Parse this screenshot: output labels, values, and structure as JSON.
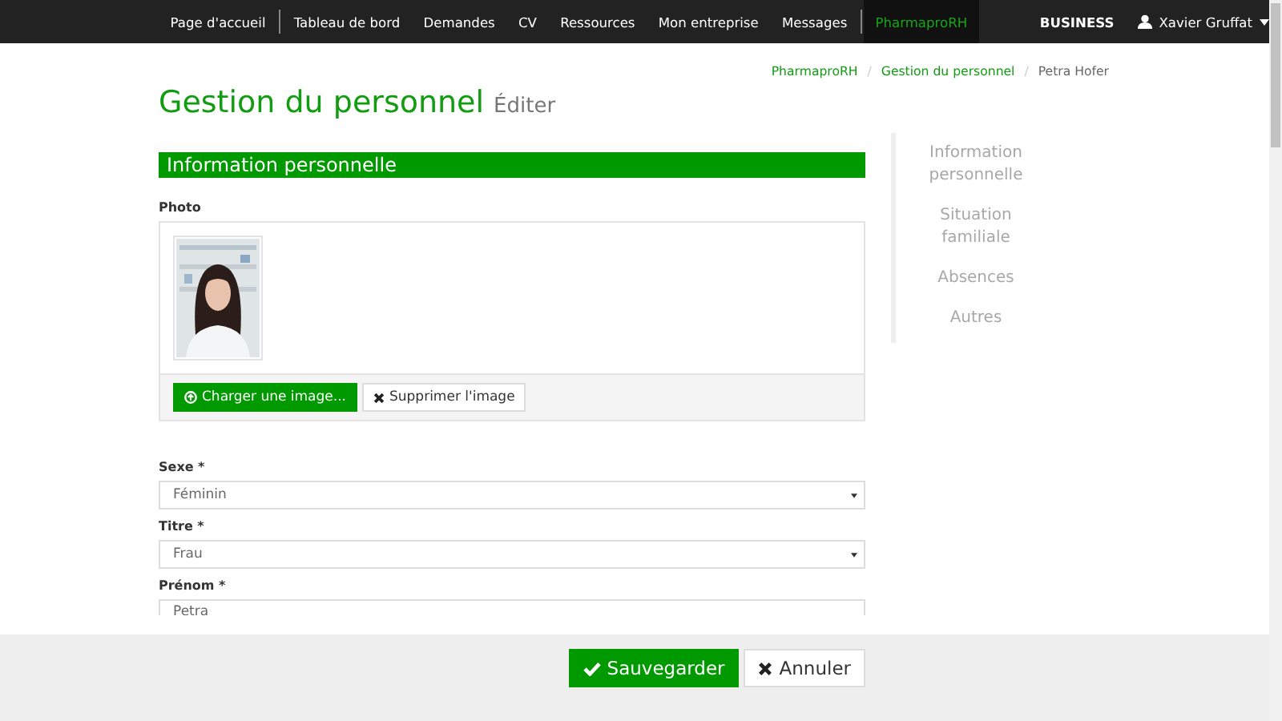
{
  "navbar": {
    "items": [
      {
        "label": "Page d'accueil",
        "selected": false,
        "separator_after": true
      },
      {
        "label": "Tableau de bord",
        "selected": false,
        "separator_after": false
      },
      {
        "label": "Demandes",
        "selected": false,
        "separator_after": false
      },
      {
        "label": "CV",
        "selected": false,
        "separator_after": false
      },
      {
        "label": "Ressources",
        "selected": false,
        "separator_after": false
      },
      {
        "label": "Mon entreprise",
        "selected": false,
        "separator_after": false
      },
      {
        "label": "Messages",
        "selected": false,
        "separator_after": true
      },
      {
        "label": "PharmaproRH",
        "selected": true,
        "separator_after": false
      }
    ],
    "brand": "BUSINESS",
    "user": "Xavier Gruffat"
  },
  "breadcrumb": [
    {
      "label": "PharmaproRH",
      "link": true
    },
    {
      "separator": "/",
      "label": "Gestion du personnel",
      "link": true
    },
    {
      "separator": "/",
      "label": "Petra Hofer",
      "link": false
    }
  ],
  "page_title": "Gestion du personnel",
  "page_subtitle": "Éditer",
  "section_title": "Information personnelle",
  "photo": {
    "label": "Photo",
    "upload_button": "Charger une image...",
    "delete_button": "Supprimer l'image"
  },
  "fields": [
    {
      "kind": "select",
      "label": "Sexe *",
      "value": "Féminin"
    },
    {
      "kind": "select",
      "label": "Titre *",
      "value": "Frau"
    },
    {
      "kind": "text",
      "label": "Prénom *",
      "value": "Petra"
    }
  ],
  "side_nav": [
    {
      "label": "Information personnelle"
    },
    {
      "label": "Situation familiale"
    },
    {
      "label": "Absences"
    },
    {
      "label": "Autres"
    }
  ],
  "footer": {
    "save_button": "Sauvegarder",
    "cancel_button": "Annuler"
  }
}
